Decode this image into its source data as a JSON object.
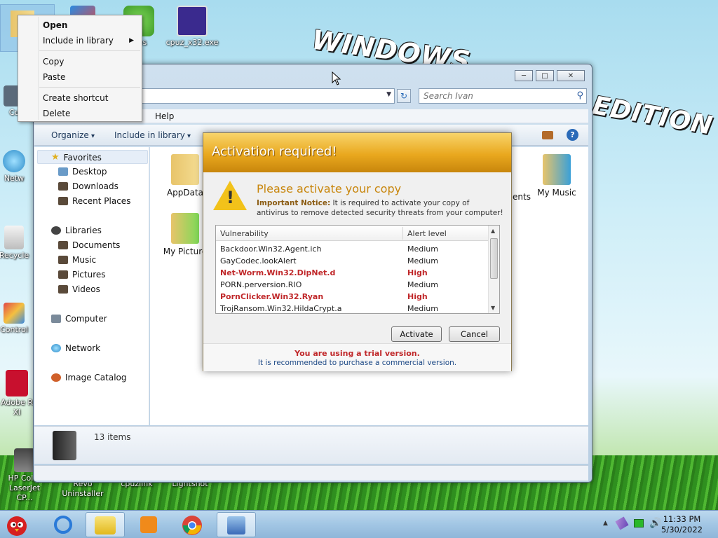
{
  "wallpaper": {
    "line1": "WINDOWS",
    "line2": "EDITION"
  },
  "desktop_icons": [
    {
      "label": "Co"
    },
    {
      "label": "Netw"
    },
    {
      "label": "Recycle"
    },
    {
      "label": "Control"
    },
    {
      "label": "Adobe R XI"
    },
    {
      "label": "HP Color LaserJet CP..."
    },
    {
      "label": "Revo Uninstaller"
    },
    {
      "label": "cpuzlink"
    },
    {
      "label": "Lightshot"
    },
    {
      "label": "gies"
    },
    {
      "label": "cpuz_x32.exe"
    }
  ],
  "context_menu": {
    "items": [
      "Open",
      "Include in library",
      "Copy",
      "Paste",
      "Create shortcut",
      "Delete"
    ]
  },
  "explorer": {
    "search_placeholder": "Search Ivan",
    "menu": {
      "help": "Help"
    },
    "commands": {
      "organize": "Organize",
      "include_library": "Include in library"
    },
    "nav": {
      "favorites": "Favorites",
      "desktop": "Desktop",
      "downloads": "Downloads",
      "recent": "Recent Places",
      "libraries": "Libraries",
      "documents": "Documents",
      "music": "Music",
      "pictures": "Pictures",
      "videos": "Videos",
      "computer": "Computer",
      "network": "Network",
      "image_catalog": "Image Catalog"
    },
    "files": {
      "appdata": "AppData",
      "my_pictures": "My Picture",
      "my_music": "My Music",
      "documents_partial": "ents"
    },
    "item_count": "13 items"
  },
  "dialog": {
    "title": "Activation required!",
    "subtitle": "Please activate your copy",
    "notice_label": "Important Notice:",
    "notice_text": "It is required to activate your copy of antivirus to remove detected security threats from your computer!",
    "columns": [
      "Vulnerability",
      "Alert level"
    ],
    "rows": [
      {
        "name": "Backdoor.Win32.Agent.ich",
        "level": "Medium"
      },
      {
        "name": "GayCodec.lookAlert",
        "level": "Medium"
      },
      {
        "name": "Net-Worm.Win32.DipNet.d",
        "level": "High"
      },
      {
        "name": "PORN.perversion.RIO",
        "level": "Medium"
      },
      {
        "name": "PornClicker.Win32.Ryan",
        "level": "High"
      },
      {
        "name": "TrojRansom.Win32.HildaCrypt.a",
        "level": "Medium"
      }
    ],
    "activate_label": "Activate",
    "cancel_label": "Cancel",
    "trial_text": "You are using a trial version.",
    "recommend_text": "It is recommended to purchase a commercial version."
  },
  "taskbar": {
    "time": "11:33 PM",
    "date": "5/30/2022"
  },
  "colors": {
    "dialog_accent": "#e9a81e",
    "high_alert": "#c0282a"
  }
}
